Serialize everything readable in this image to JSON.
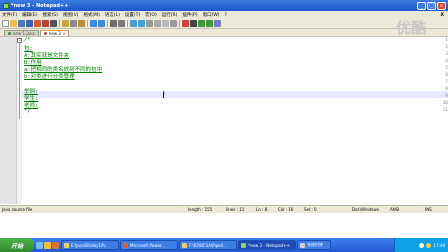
{
  "window": {
    "title": "*new 3 - Notepad++",
    "buttons": {
      "minimize": "_",
      "maximize": "□",
      "close": "x"
    }
  },
  "menu": {
    "items": [
      "文件(F)",
      "编辑(E)",
      "搜索(S)",
      "视图(V)",
      "格式(M)",
      "语言(L)",
      "设置(T)",
      "宏(O)",
      "运行(R)",
      "插件(P)",
      "窗口(W)",
      "?"
    ],
    "close_x": "X"
  },
  "tabs": [
    {
      "label": "new 1.java",
      "active": false
    },
    {
      "label": "new 3",
      "active": true,
      "close": "x"
    }
  ],
  "editor": {
    "line_numbers": [
      "1",
      "2",
      "3",
      "4",
      "5",
      "6",
      "7",
      "8",
      "9",
      "10",
      "11"
    ],
    "lines": [
      "/*",
      "    包:",
      "        A:其实就是文件夹",
      "        B:作用",
      "            a:把相同的类名放到不同的包中",
      "            b:对类进行分类管理",
      "",
      "    举例:",
      "        学生:",
      "        老师:",
      "*/"
    ]
  },
  "status": {
    "filetype": "Java source file",
    "length": "length : 155",
    "lines": "lines : 11",
    "ln": "Ln : 8",
    "col": "Col : 16",
    "sel": "Sel : 0",
    "eol": "Dos\\Windows",
    "encoding": "ANSI",
    "mode": "INS"
  },
  "taskbar": {
    "start": "开始",
    "tasks": [
      {
        "label": "E:\\JavaSE\\day10\\..."
      },
      {
        "label": "Microsoft Power..."
      },
      {
        "label": "F:\\02\\BCSA\\Pipeli..."
      },
      {
        "label": "*new 3 - Notepad++",
        "active": true
      },
      {
        "label": "系统时钟"
      }
    ],
    "clock": "17:49"
  },
  "watermark": "优酷",
  "colors": {
    "comment": "#008000",
    "titlebar": "#2a66d8",
    "taskbar": "#2f6ee0"
  }
}
